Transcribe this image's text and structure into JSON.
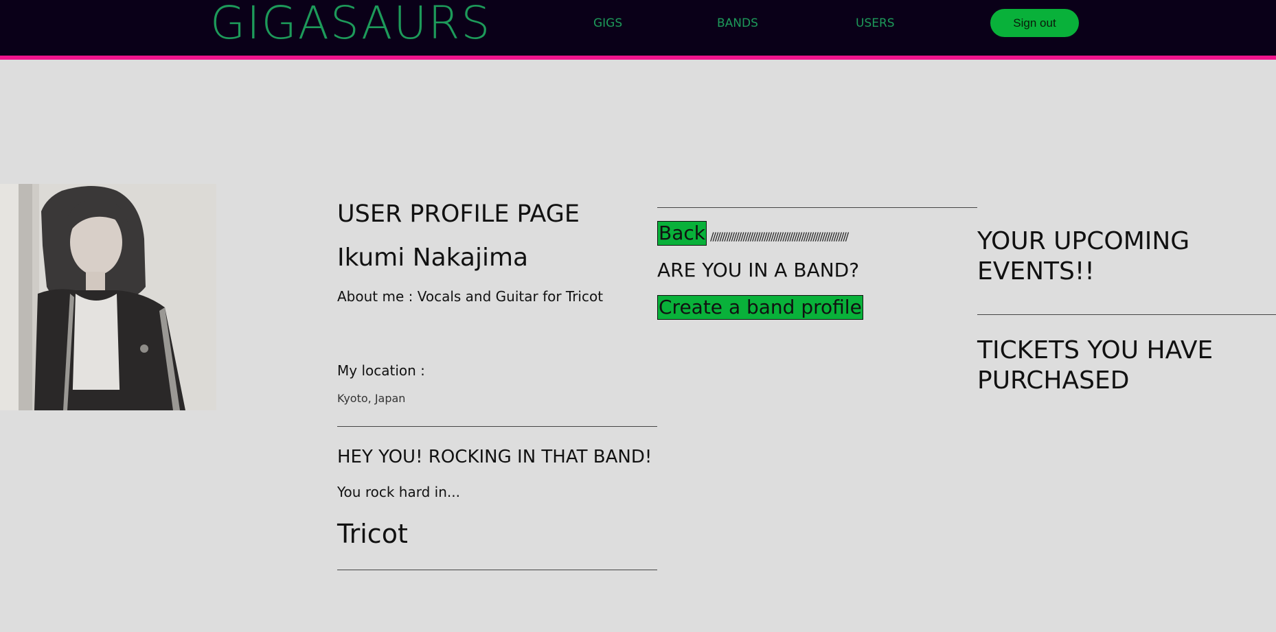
{
  "nav": {
    "logo": "GIGASAURS",
    "links": [
      "GIGS",
      "BANDS",
      "USERS"
    ],
    "signout_label": "Sign out",
    "accent_color": "#1d9a5a",
    "border_color": "#f0148c",
    "button_color": "#09b13a"
  },
  "profile": {
    "page_title": "USER PROFILE PAGE",
    "name": "Ikumi Nakajima",
    "about": "About me : Vocals and Guitar for Tricot",
    "location_label": "My location :",
    "location_value": "Kyoto, Japan",
    "band_heading": "HEY YOU! ROCKING IN THAT BAND!",
    "rock_text": "You rock hard in...",
    "band_name": "Tricot"
  },
  "actions": {
    "back_label": "Back",
    "separator": "///////////////////////////////////////////////////////////",
    "band_question": "ARE YOU IN A BAND?",
    "create_band_label": "Create a band profile"
  },
  "events": {
    "upcoming_heading": "YOUR UPCOMING EVENTS!!",
    "tickets_heading": "TICKETS YOU HAVE PURCHASED"
  }
}
